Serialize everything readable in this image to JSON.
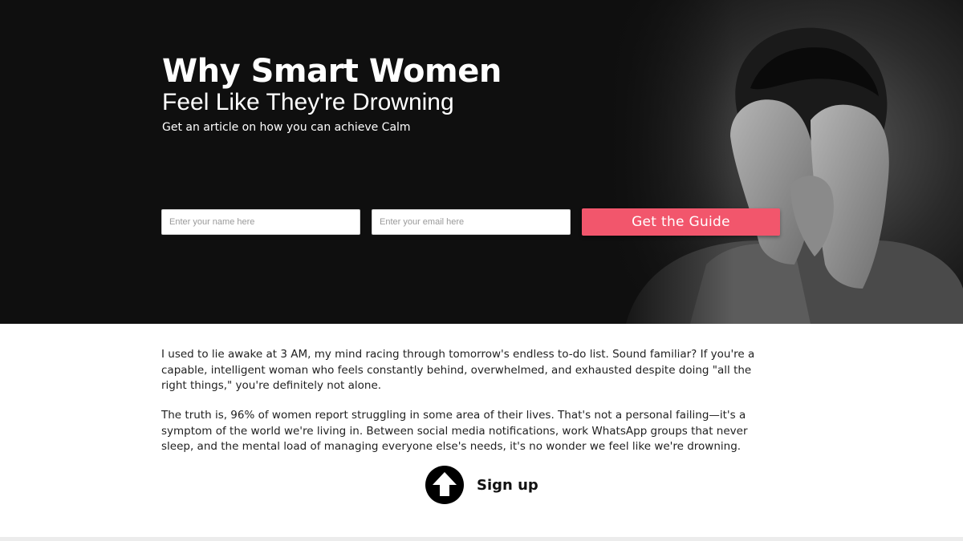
{
  "hero": {
    "title_line1": "Why Smart Women",
    "title_line2": "Feel Like They're Drowning",
    "subtitle": "Get an article on how you can achieve Calm",
    "background_color": "#0f0f0f",
    "image": "man-covering-face-photo"
  },
  "form": {
    "name_placeholder": "Enter your name here",
    "email_placeholder": "Enter your email here",
    "submit_label": "Get the Guide",
    "submit_color": "#f2566c"
  },
  "body": {
    "paragraph_1": "I used to lie awake at 3 AM, my mind racing through tomorrow's endless to-do list. Sound familiar? If you're a capable, intelligent woman who feels constantly behind, overwhelmed, and exhausted despite doing \"all the right things,\" you're definitely not alone.",
    "paragraph_2": "The truth is, 96% of women report struggling in some area of their lives. That's not a personal failing—it's a symptom of the world we're living in. Between social media notifications, work WhatsApp groups that never sleep, and the mental load of managing everyone else's needs, it's no wonder we feel like we're drowning."
  },
  "signup": {
    "label": "Sign up",
    "icon": "arrow-up-circle-icon"
  }
}
